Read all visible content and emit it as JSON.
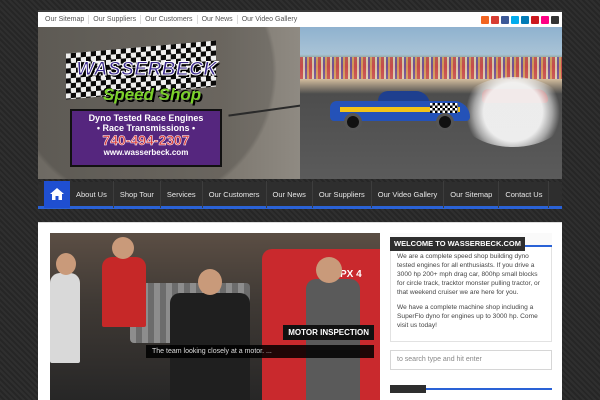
{
  "topnav": [
    "Our Sitemap",
    "Our Suppliers",
    "Our Customers",
    "Our News",
    "Our Video Gallery"
  ],
  "social_icons": [
    {
      "name": "rss-icon",
      "color": "#f26522"
    },
    {
      "name": "google-plus-icon",
      "color": "#d73d32"
    },
    {
      "name": "facebook-icon",
      "color": "#3b5998"
    },
    {
      "name": "twitter-icon",
      "color": "#00aced"
    },
    {
      "name": "linkedin-icon",
      "color": "#007bb6"
    },
    {
      "name": "youtube-icon",
      "color": "#cc181e"
    },
    {
      "name": "flickr-icon",
      "color": "#ff0084"
    },
    {
      "name": "other-icon",
      "color": "#333333"
    }
  ],
  "logo": {
    "title": "WASSERBECK",
    "subtitle": "Speed Shop",
    "line1": "Dyno Tested Race Engines",
    "line2": "• Race Transmissions •",
    "phone": "740-494-2307",
    "url": "www.wasserbeck.com"
  },
  "mainnav": [
    "About Us",
    "Shop Tour",
    "Services",
    "Our Customers",
    "Our News",
    "Our Suppliers",
    "Our Video Gallery",
    "Our Sitemap",
    "Contact Us"
  ],
  "slider": {
    "title": "MOTOR INSPECTION",
    "caption": "The team looking closely at a motor. ..."
  },
  "widget": {
    "title": "WELCOME TO WASSERBECK.COM",
    "p1": "We are a complete speed shop building dyno tested engines for all enthusiasts. If you drive a 3000 hp 200+ mph drag car, 800hp small blocks for circle track, tracktor monster pulling tractor, or that weekend cruiser we are here for you.",
    "p2": "We have a complete machine shop including a SuperFlo dyno for engines up to 3000 hp. Come visit us today!"
  },
  "search": {
    "placeholder": "to search type and hit enter"
  },
  "colors": {
    "accent": "#2a62d6",
    "dark": "#2e2e2e"
  }
}
